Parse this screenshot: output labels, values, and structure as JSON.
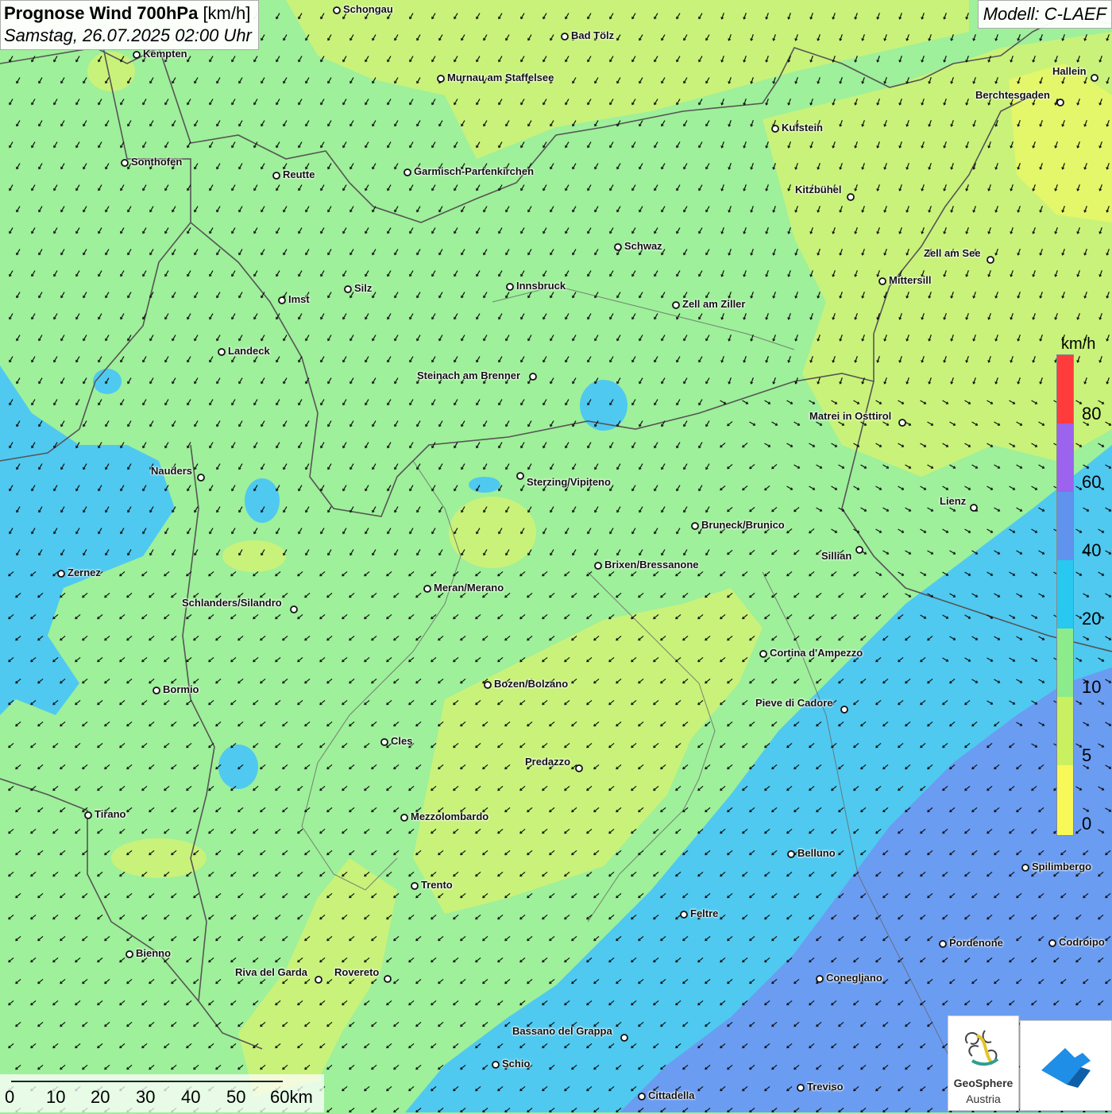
{
  "header": {
    "title_bold": "Prognose Wind 700hPa",
    "title_unit": "[km/h]",
    "datetime": "Samstag, 26.07.2025 02:00 Uhr"
  },
  "model_label": "Modell: C-LAEF",
  "legend": {
    "unit": "km/h",
    "labels": [
      "80",
      "60",
      "40",
      "20",
      "10",
      "5",
      "0"
    ],
    "colors": [
      "#ff3b3b",
      "#9b63ee",
      "#5f93ee",
      "#28c8f0",
      "#8ceb8a",
      "#c8f060",
      "#f8f858"
    ]
  },
  "scale_bar": {
    "ticks": [
      "0",
      "10",
      "20",
      "30",
      "40",
      "50",
      "60km"
    ]
  },
  "logos": {
    "geosphere_line1": "GeoSphere",
    "geosphere_line2": "Austria",
    "geosphere_icon": "geosphere-logo-icon",
    "app_icon": "geosphere-app-icon"
  },
  "map_colors": {
    "green": "#9ef09a",
    "yellow_green": "#c9f27a",
    "light_blue": "#4fc9f0",
    "blue": "#6a9cf2",
    "border": "#555555",
    "arrow": "#111111"
  },
  "cities": [
    {
      "name": "Schongau"
    },
    {
      "name": "Bad Tölz"
    },
    {
      "name": "Kempten"
    },
    {
      "name": "Murnau am Staffelsee"
    },
    {
      "name": "Hallein"
    },
    {
      "name": "Berchtesgaden"
    },
    {
      "name": "Kufstein"
    },
    {
      "name": "Sonthofen"
    },
    {
      "name": "Reutte"
    },
    {
      "name": "Garmisch-Partenkirchen"
    },
    {
      "name": "Kitzbühel"
    },
    {
      "name": "Schwaz"
    },
    {
      "name": "Zell am See"
    },
    {
      "name": "Mittersill"
    },
    {
      "name": "Silz"
    },
    {
      "name": "Innsbruck"
    },
    {
      "name": "Imst"
    },
    {
      "name": "Zell am Ziller"
    },
    {
      "name": "Landeck"
    },
    {
      "name": "Steinach am Brenner"
    },
    {
      "name": "Matrei in Osttirol"
    },
    {
      "name": "Nauders"
    },
    {
      "name": "Sterzing/Vipiteno"
    },
    {
      "name": "Lienz"
    },
    {
      "name": "Bruneck/Brunico"
    },
    {
      "name": "Sillian"
    },
    {
      "name": "Brixen/Bressanone"
    },
    {
      "name": "Zernez"
    },
    {
      "name": "Meran/Merano"
    },
    {
      "name": "Schlanders/Silandro"
    },
    {
      "name": "Cortina d'Ampezzo"
    },
    {
      "name": "Bozen/Bolzano"
    },
    {
      "name": "Bormio"
    },
    {
      "name": "Pieve di Cadore"
    },
    {
      "name": "Cles"
    },
    {
      "name": "Predazzo"
    },
    {
      "name": "Tirano"
    },
    {
      "name": "Mezzolombardo"
    },
    {
      "name": "Belluno"
    },
    {
      "name": "Spilimbergo"
    },
    {
      "name": "Trento"
    },
    {
      "name": "Feltre"
    },
    {
      "name": "Bienno"
    },
    {
      "name": "Pordenone"
    },
    {
      "name": "Codroipo"
    },
    {
      "name": "Riva del Garda"
    },
    {
      "name": "Rovereto"
    },
    {
      "name": "Conegliano"
    },
    {
      "name": "Bassano del Grappa"
    },
    {
      "name": "Schio"
    },
    {
      "name": "Treviso"
    },
    {
      "name": "Cittadella"
    }
  ]
}
